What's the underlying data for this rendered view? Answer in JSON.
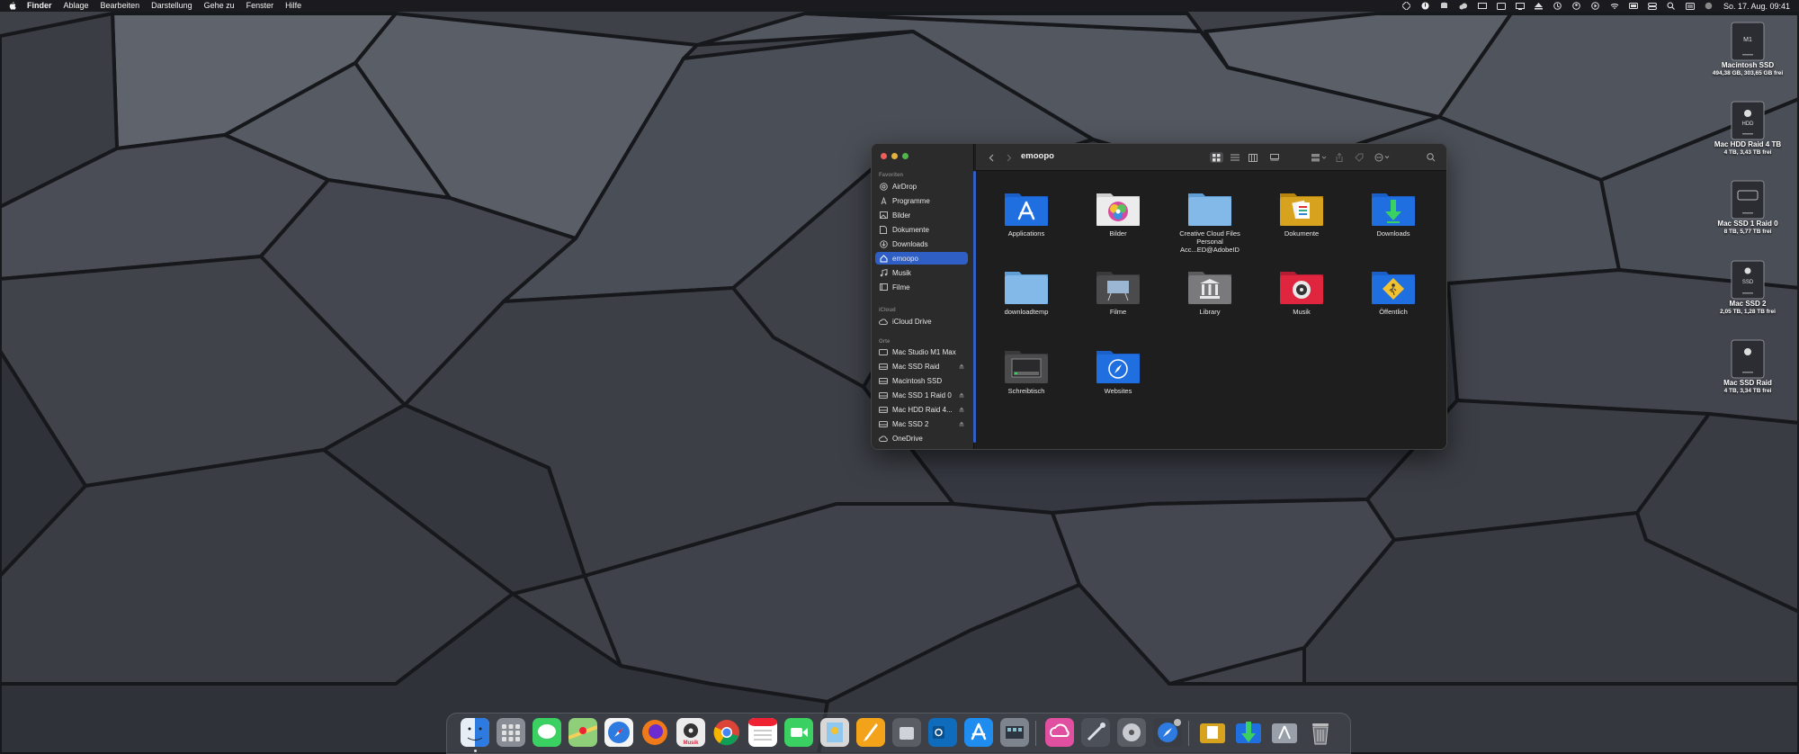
{
  "menubar": {
    "app_name": "Finder",
    "menus": [
      "Ablage",
      "Bearbeiten",
      "Darstellung",
      "Gehe zu",
      "Fenster",
      "Hilfe"
    ],
    "clock": "So. 17. Aug. 09:41"
  },
  "desktop_drives": [
    {
      "name": "Macintosh SSD",
      "info": "494,38 GB, 303,65 GB frei",
      "label": "M1"
    },
    {
      "name": "Mac HDD Raid 4 TB",
      "info": "4 TB, 3,43 TB frei",
      "label": "HDD"
    },
    {
      "name": "Mac SSD 1 Raid 0",
      "info": "8 TB, 5,77 TB frei",
      "label": ""
    },
    {
      "name": "Mac SSD 2",
      "info": "2,05 TB, 1,28 TB frei",
      "label": "SSD"
    },
    {
      "name": "Mac SSD Raid",
      "info": "4 TB, 3,34 TB frei",
      "label": ""
    }
  ],
  "finder": {
    "title": "emoopo",
    "sidebar": {
      "sections": [
        "Favoriten",
        "iCloud",
        "Orte"
      ],
      "favorites": [
        "AirDrop",
        "Programme",
        "Bilder",
        "Dokumente",
        "Downloads",
        "emoopo",
        "Musik",
        "Filme"
      ],
      "icloud": [
        "iCloud Drive"
      ],
      "places": [
        "Mac Studio M1 Max",
        "Mac SSD Raid",
        "Macintosh SSD",
        "Mac SSD 1 Raid 0",
        "Mac HDD Raid 4...",
        "Mac SSD 2",
        "OneDrive"
      ]
    },
    "items": [
      {
        "label": "Applications",
        "label2": "",
        "icon": "applications-folder-icon",
        "color": "#1f6fe0"
      },
      {
        "label": "Bilder",
        "label2": "",
        "icon": "pictures-folder-icon",
        "color": "#e9e9e9"
      },
      {
        "label": "Creative Cloud Files",
        "label2": "Personal Acc...ED@AdobeID",
        "icon": "creative-cloud-folder-icon",
        "color": "#7bb6e6"
      },
      {
        "label": "Dokumente",
        "label2": "",
        "icon": "documents-folder-icon",
        "color": "#d7a21e"
      },
      {
        "label": "Downloads",
        "label2": "",
        "icon": "downloads-folder-icon",
        "color": "#1f6fe0"
      },
      {
        "label": "downloadtemp",
        "label2": "",
        "icon": "folder-icon",
        "color": "#7bb6e6"
      },
      {
        "label": "Filme",
        "label2": "",
        "icon": "movies-folder-icon",
        "color": "#555"
      },
      {
        "label": "Library",
        "label2": "",
        "icon": "library-folder-icon",
        "color": "#7a7a7a"
      },
      {
        "label": "Musik",
        "label2": "",
        "icon": "music-folder-icon",
        "color": "#e0263f"
      },
      {
        "label": "Öffentlich",
        "label2": "",
        "icon": "public-folder-icon",
        "color": "#1f6fe0"
      },
      {
        "label": "Schreibtisch",
        "label2": "",
        "icon": "desktop-folder-icon",
        "color": "#444"
      },
      {
        "label": "Websites",
        "label2": "",
        "icon": "websites-folder-icon",
        "color": "#1f6fe0"
      }
    ]
  },
  "dock": {
    "apps": [
      "finder",
      "launchpad",
      "messages",
      "maps",
      "safari",
      "firefox",
      "music",
      "chrome",
      "calendar",
      "facetime",
      "preview",
      "pages",
      "mac-studio",
      "outlook",
      "app-store",
      "system-info",
      "keychain",
      "creative-cloud",
      "vectorworks",
      "disk-utility",
      "safari-2",
      "downloads-stack",
      "documents-stack",
      "trash"
    ],
    "music_label": "Musik"
  },
  "colors": {
    "selection": "#2f5fc4",
    "traffic_red": "#ec5f5a",
    "traffic_yellow": "#e3b23b",
    "traffic_green": "#4fb74a"
  }
}
